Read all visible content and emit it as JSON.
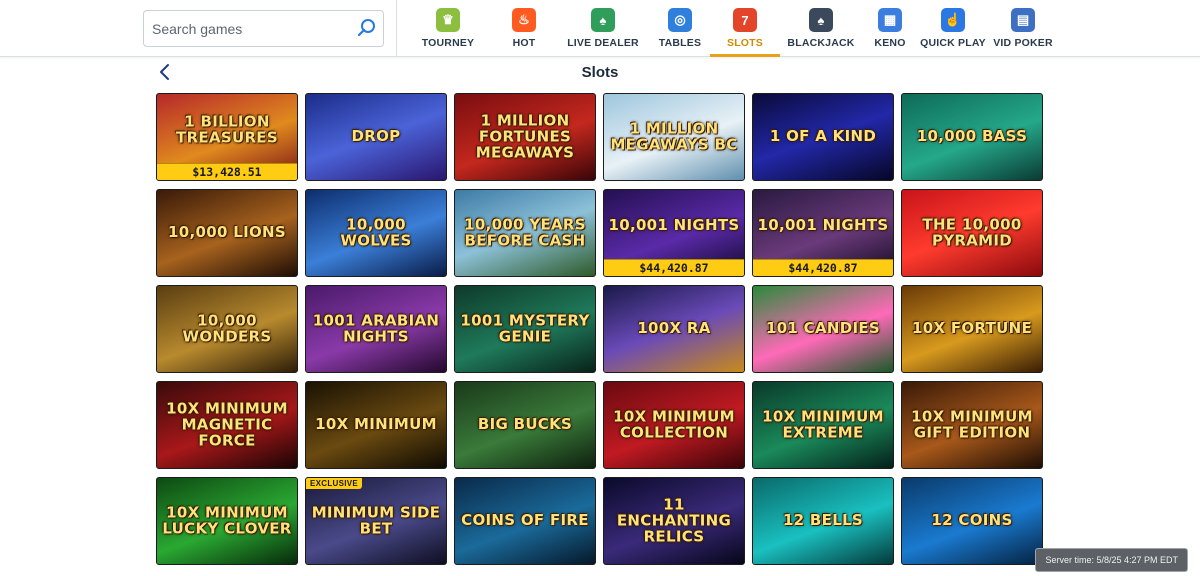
{
  "search": {
    "placeholder": "Search games"
  },
  "nav": [
    {
      "label": "TOURNEY",
      "icon": "trophy-icon",
      "color": "#8cbf3f",
      "glyph": "♛"
    },
    {
      "label": "HOT",
      "icon": "flame-icon",
      "color": "#ff5a1f",
      "glyph": "♨"
    },
    {
      "label": "LIVE DEALER",
      "icon": "live-dealer-icon",
      "color": "#2f9e5b",
      "glyph": "♠"
    },
    {
      "label": "TABLES",
      "icon": "chips-icon",
      "color": "#2f7fdc",
      "glyph": "◎"
    },
    {
      "label": "SLOTS",
      "icon": "slot-machine-icon",
      "color": "#e2452a",
      "glyph": "7"
    },
    {
      "label": "BLACKJACK",
      "icon": "cards-icon",
      "color": "#3a4a5c",
      "glyph": "♠"
    },
    {
      "label": "KENO",
      "icon": "keno-icon",
      "color": "#3b7ee0",
      "glyph": "▦"
    },
    {
      "label": "QUICK PLAY",
      "icon": "quick-play-icon",
      "color": "#2a78e4",
      "glyph": "☝"
    },
    {
      "label": "VID POKER",
      "icon": "video-poker-icon",
      "color": "#3d6fc2",
      "glyph": "▤"
    }
  ],
  "active_nav": "SLOTS",
  "page": {
    "title": "Slots"
  },
  "games": [
    {
      "name": "1 Billion Treasures",
      "jackpot": "$13,428.51",
      "bg": "linear-gradient(160deg,#b6282a,#e08a1e 55%,#7a1418)"
    },
    {
      "name": "Drop",
      "bg": "linear-gradient(160deg,#1b2d8a,#4b63d8 50%,#2a1670)"
    },
    {
      "name": "1 Million Fortunes Megaways",
      "bg": "linear-gradient(160deg,#7a0d10,#c4281e 55%,#3a0508)"
    },
    {
      "name": "1 Million Megaways BC",
      "bg": "linear-gradient(160deg,#9ec6de,#e8f1f6 55%,#5f8fae)"
    },
    {
      "name": "1 of a Kind",
      "bg": "linear-gradient(160deg,#0a0a3a,#2228a8 50%,#060626)"
    },
    {
      "name": "10,000 Bass",
      "bg": "linear-gradient(160deg,#0e6b58,#25a88a 55%,#0a3b33)"
    },
    {
      "name": "10,000 Lions",
      "bg": "linear-gradient(160deg,#3a1a08,#a7621e 55%,#1f0e05)"
    },
    {
      "name": "10,000 Wolves",
      "bg": "linear-gradient(160deg,#0d2e6e,#3b7fd8 55%,#0a1c48)"
    },
    {
      "name": "10,000 Years Before Cash",
      "bg": "linear-gradient(160deg,#3d7ba6,#8cc1d8 50%,#2e5a2a)"
    },
    {
      "name": "10,001 Nights",
      "jackpot": "$44,420.87",
      "bg": "linear-gradient(160deg,#241052,#5a2aa8 55%,#12082e)"
    },
    {
      "name": "10,001 Nights",
      "jackpot": "$44,420.87",
      "bg": "linear-gradient(160deg,#2a1a40,#6a3a7a 55%,#140a22)"
    },
    {
      "name": "The 10,000 Pyramid",
      "bg": "linear-gradient(160deg,#c8141a,#ff3b2e 50%,#8a0a0e)"
    },
    {
      "name": "10,000 Wonders",
      "bg": "linear-gradient(160deg,#5a3e12,#b88a2e 55%,#2e1e08)"
    },
    {
      "name": "1001 Arabian Nights",
      "bg": "linear-gradient(160deg,#4a1a6a,#8a3aa8 55%,#24082e)"
    },
    {
      "name": "1001 Mystery Genie",
      "bg": "linear-gradient(160deg,#0e3a2a,#1f7a5a 55%,#08221a)"
    },
    {
      "name": "100x Ra",
      "bg": "linear-gradient(160deg,#1a1a4a,#6a4ab8 50%,#c88a1a)"
    },
    {
      "name": "101 Candies",
      "bg": "linear-gradient(160deg,#2a8a3a,#ff6ab8 55%,#1a5a28)"
    },
    {
      "name": "10x Fortune",
      "bg": "linear-gradient(160deg,#6a3a08,#d89a1e 55%,#3a1e04)"
    },
    {
      "name": "10x Minimum Magnetic Force",
      "bg": "linear-gradient(160deg,#3a0a0a,#a8181a 55%,#1a0404)"
    },
    {
      "name": "10x Minimum",
      "bg": "linear-gradient(160deg,#1a1204,#6a4a10 55%,#0e0a02)"
    },
    {
      "name": "Big Bucks",
      "bg": "linear-gradient(160deg,#1a3a1a,#3a7a3a 55%,#0e200e)"
    },
    {
      "name": "10x Minimum Collection",
      "bg": "linear-gradient(160deg,#6a0a10,#c01a22 55%,#3a0408)"
    },
    {
      "name": "10x Minimum Extreme",
      "bg": "linear-gradient(160deg,#0a3a2a,#1a8a5a 55%,#04201a)"
    },
    {
      "name": "10x Minimum Gift Edition",
      "bg": "linear-gradient(160deg,#3a1a08,#a8581a 55%,#1e0e04)"
    },
    {
      "name": "10x Minimum Lucky Clover",
      "bg": "linear-gradient(160deg,#0e4a12,#2aa832 55%,#072a0a)"
    },
    {
      "name": "Minimum Side Bet",
      "badge": "EXCLUSIVE",
      "bg": "linear-gradient(160deg,#1a1a3a,#4a4a8a 55%,#0e0e22)"
    },
    {
      "name": "Coins of Fire",
      "bg": "linear-gradient(160deg,#0a2a4a,#1a6a9a 55%,#06182a)"
    },
    {
      "name": "11 Enchanting Relics",
      "bg": "linear-gradient(160deg,#0a0a2a,#3a2a7a 55%,#06061a)"
    },
    {
      "name": "12 Bells",
      "bg": "linear-gradient(160deg,#0a6a6a,#1ac0c0 55%,#043a3a)"
    },
    {
      "name": "12 Coins",
      "bg": "linear-gradient(160deg,#0a3a6a,#1a7ad0 55%,#042240)"
    }
  ],
  "server": {
    "text": "Server time: 5/8/25 4:27 PM EDT"
  }
}
